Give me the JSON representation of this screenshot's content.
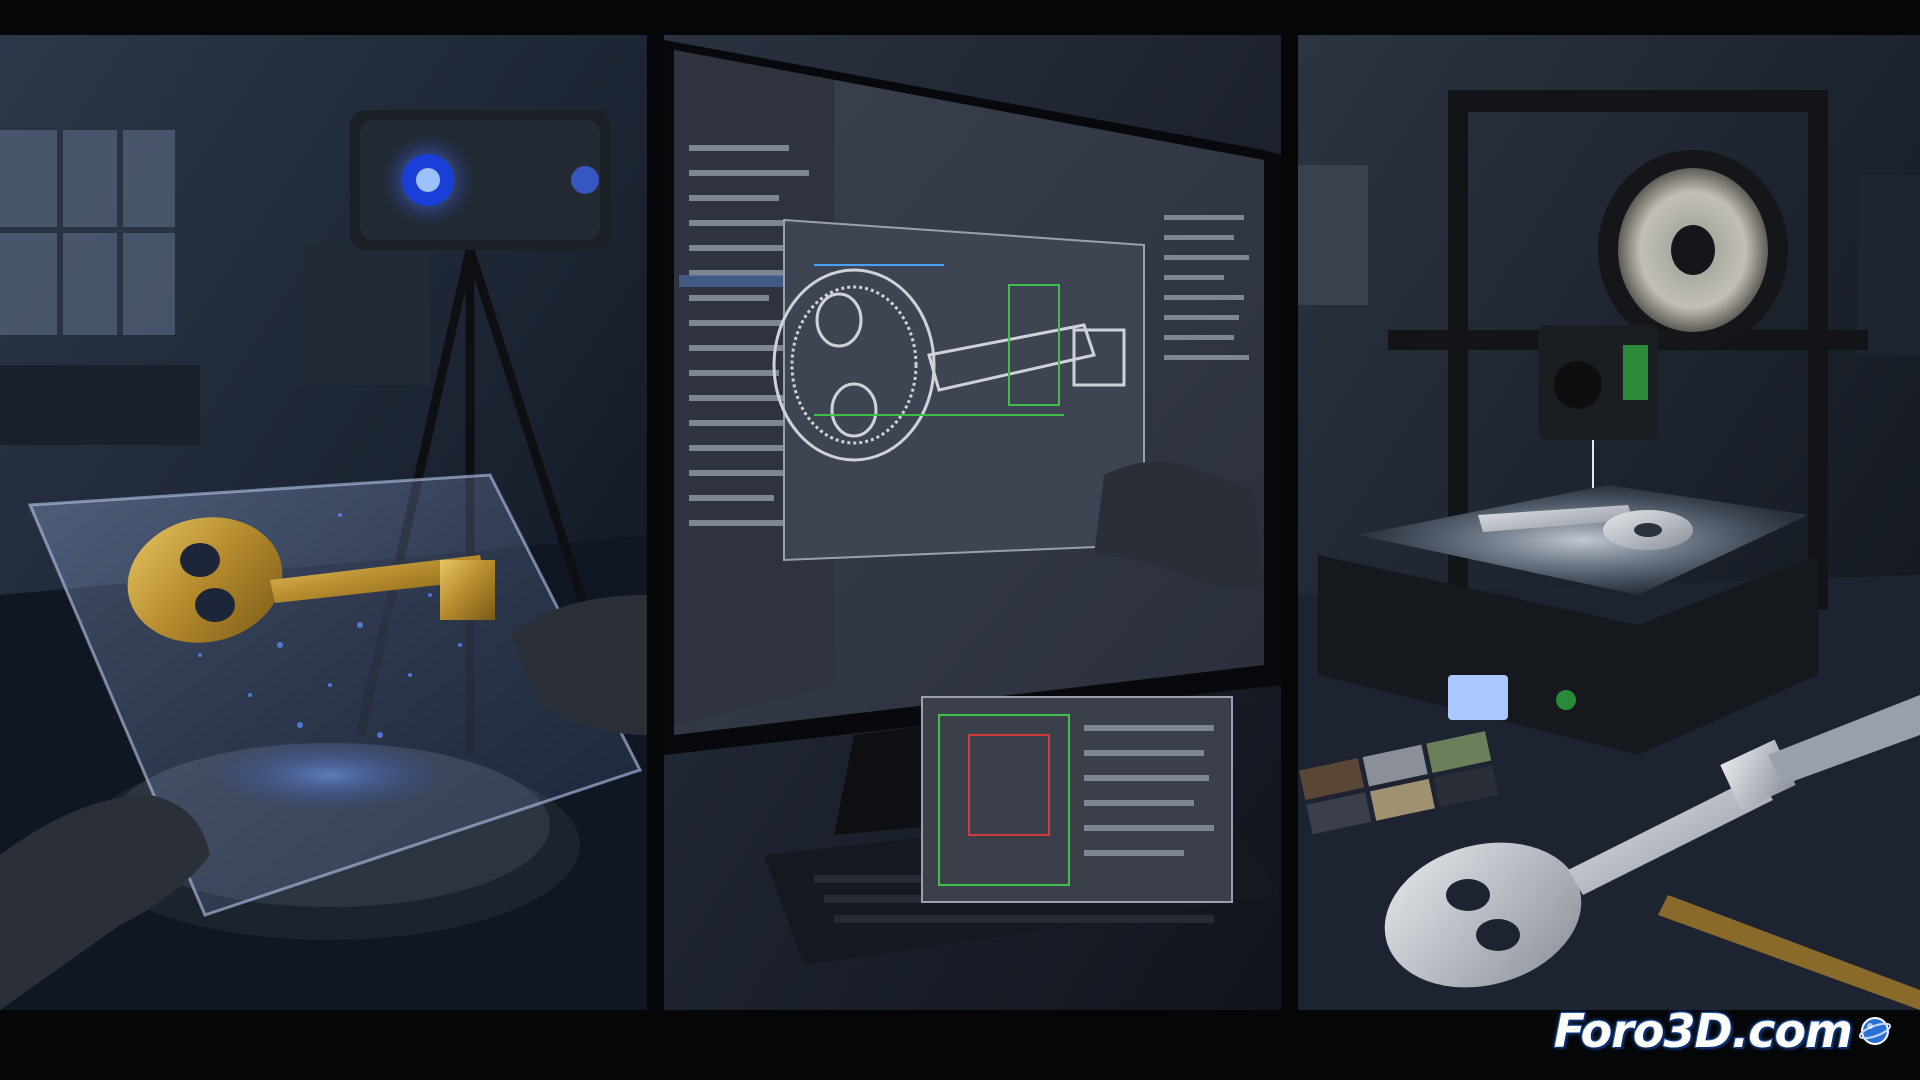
{
  "watermark": {
    "text": "Foro3D.com",
    "icon": "globe-icon",
    "stroke_color": "#1b4fa8"
  },
  "panels": [
    {
      "id": "scan",
      "icon": "camera-icon"
    },
    {
      "id": "design",
      "icon": "monitor-icon"
    },
    {
      "id": "print",
      "icon": "printer-icon"
    }
  ],
  "colors": {
    "scan_glow": "#3a6dff",
    "key_gold": "#c9a444",
    "wireframe": "#cfd3d8",
    "axis_green": "#3fbf4a",
    "axis_red": "#d03a3a",
    "bed_light": "#e8eef8"
  }
}
